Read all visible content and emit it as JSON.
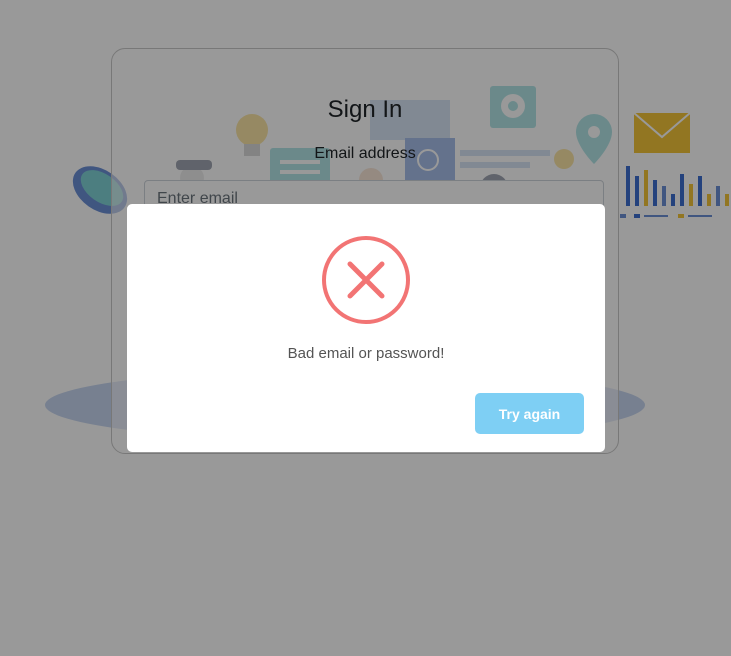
{
  "signin": {
    "title": "Sign In",
    "email_label": "Email address",
    "email_placeholder": "Enter email",
    "email_value": ""
  },
  "alert": {
    "icon": "error-x-icon",
    "message": "Bad email or password!",
    "button_label": "Try again"
  },
  "colors": {
    "error_red": "#f27474",
    "button_blue": "#7ecff4",
    "illustration_blue": "#c7d9ef",
    "illustration_yellow": "#f3c53a",
    "illustration_teal": "#57c5c9"
  }
}
